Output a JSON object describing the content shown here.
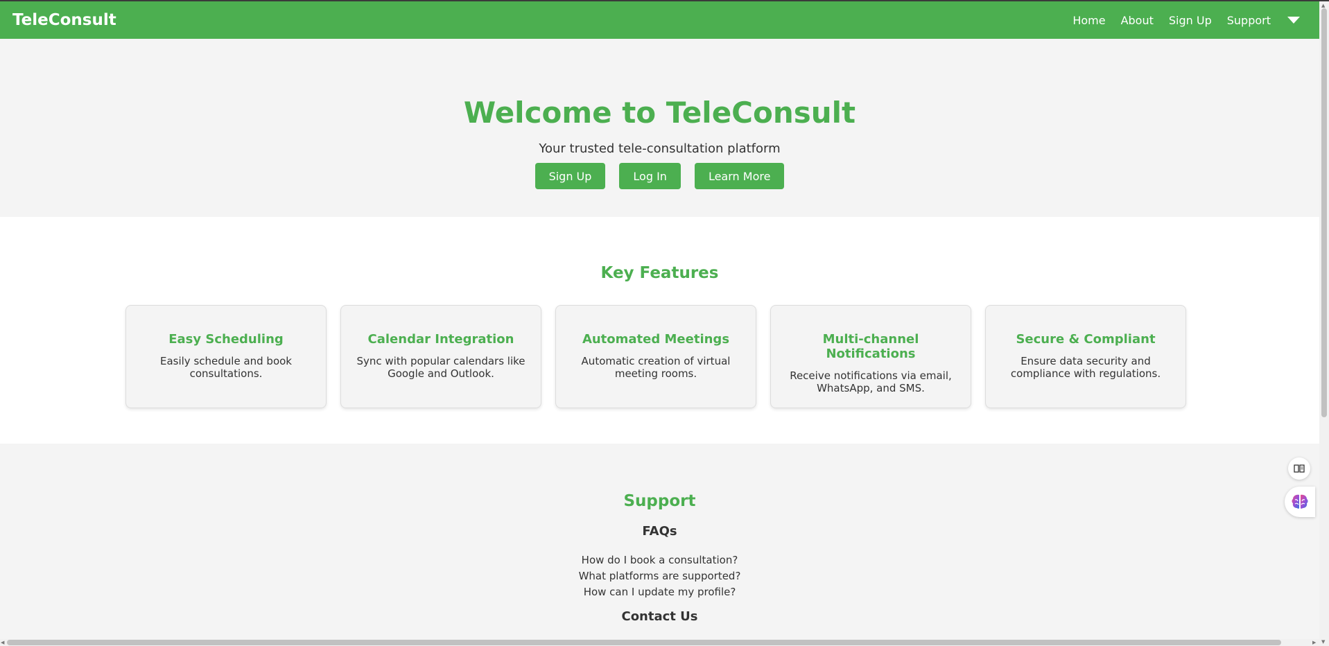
{
  "header": {
    "brand": "TeleConsult",
    "nav": {
      "home": "Home",
      "about": "About",
      "signup": "Sign Up",
      "support": "Support"
    }
  },
  "hero": {
    "title": "Welcome to TeleConsult",
    "subtitle": "Your trusted tele-consultation platform",
    "buttons": {
      "signup": "Sign Up",
      "login": "Log In",
      "learn_more": "Learn More"
    }
  },
  "features": {
    "title": "Key Features",
    "items": [
      {
        "title": "Easy Scheduling",
        "line1": "Easily schedule and book",
        "line2": "consultations."
      },
      {
        "title": "Calendar Integration",
        "line1": "Sync with popular calendars like",
        "line2": "Google and Outlook."
      },
      {
        "title": "Automated Meetings",
        "line1": "Automatic creation of virtual",
        "line2": "meeting rooms."
      },
      {
        "title": "Multi-channel Notifications",
        "line1": "Receive notifications via email,",
        "line2": "WhatsApp, and SMS."
      },
      {
        "title": "Secure & Compliant",
        "line1": "Ensure data security and",
        "line2": "compliance with regulations."
      }
    ]
  },
  "support": {
    "title": "Support",
    "faq_title": "FAQs",
    "faqs": [
      "How do I book a consultation?",
      "What platforms are supported?",
      "How can I update my profile?"
    ],
    "contact_title": "Contact Us"
  },
  "colors": {
    "brand": "#4caf50",
    "light_bg": "#f4f4f4",
    "text": "#333333"
  },
  "icons": {
    "support_dropdown": "chevron-down-icon",
    "floating_1": "book-reader-icon",
    "floating_2": "brain-icon"
  }
}
